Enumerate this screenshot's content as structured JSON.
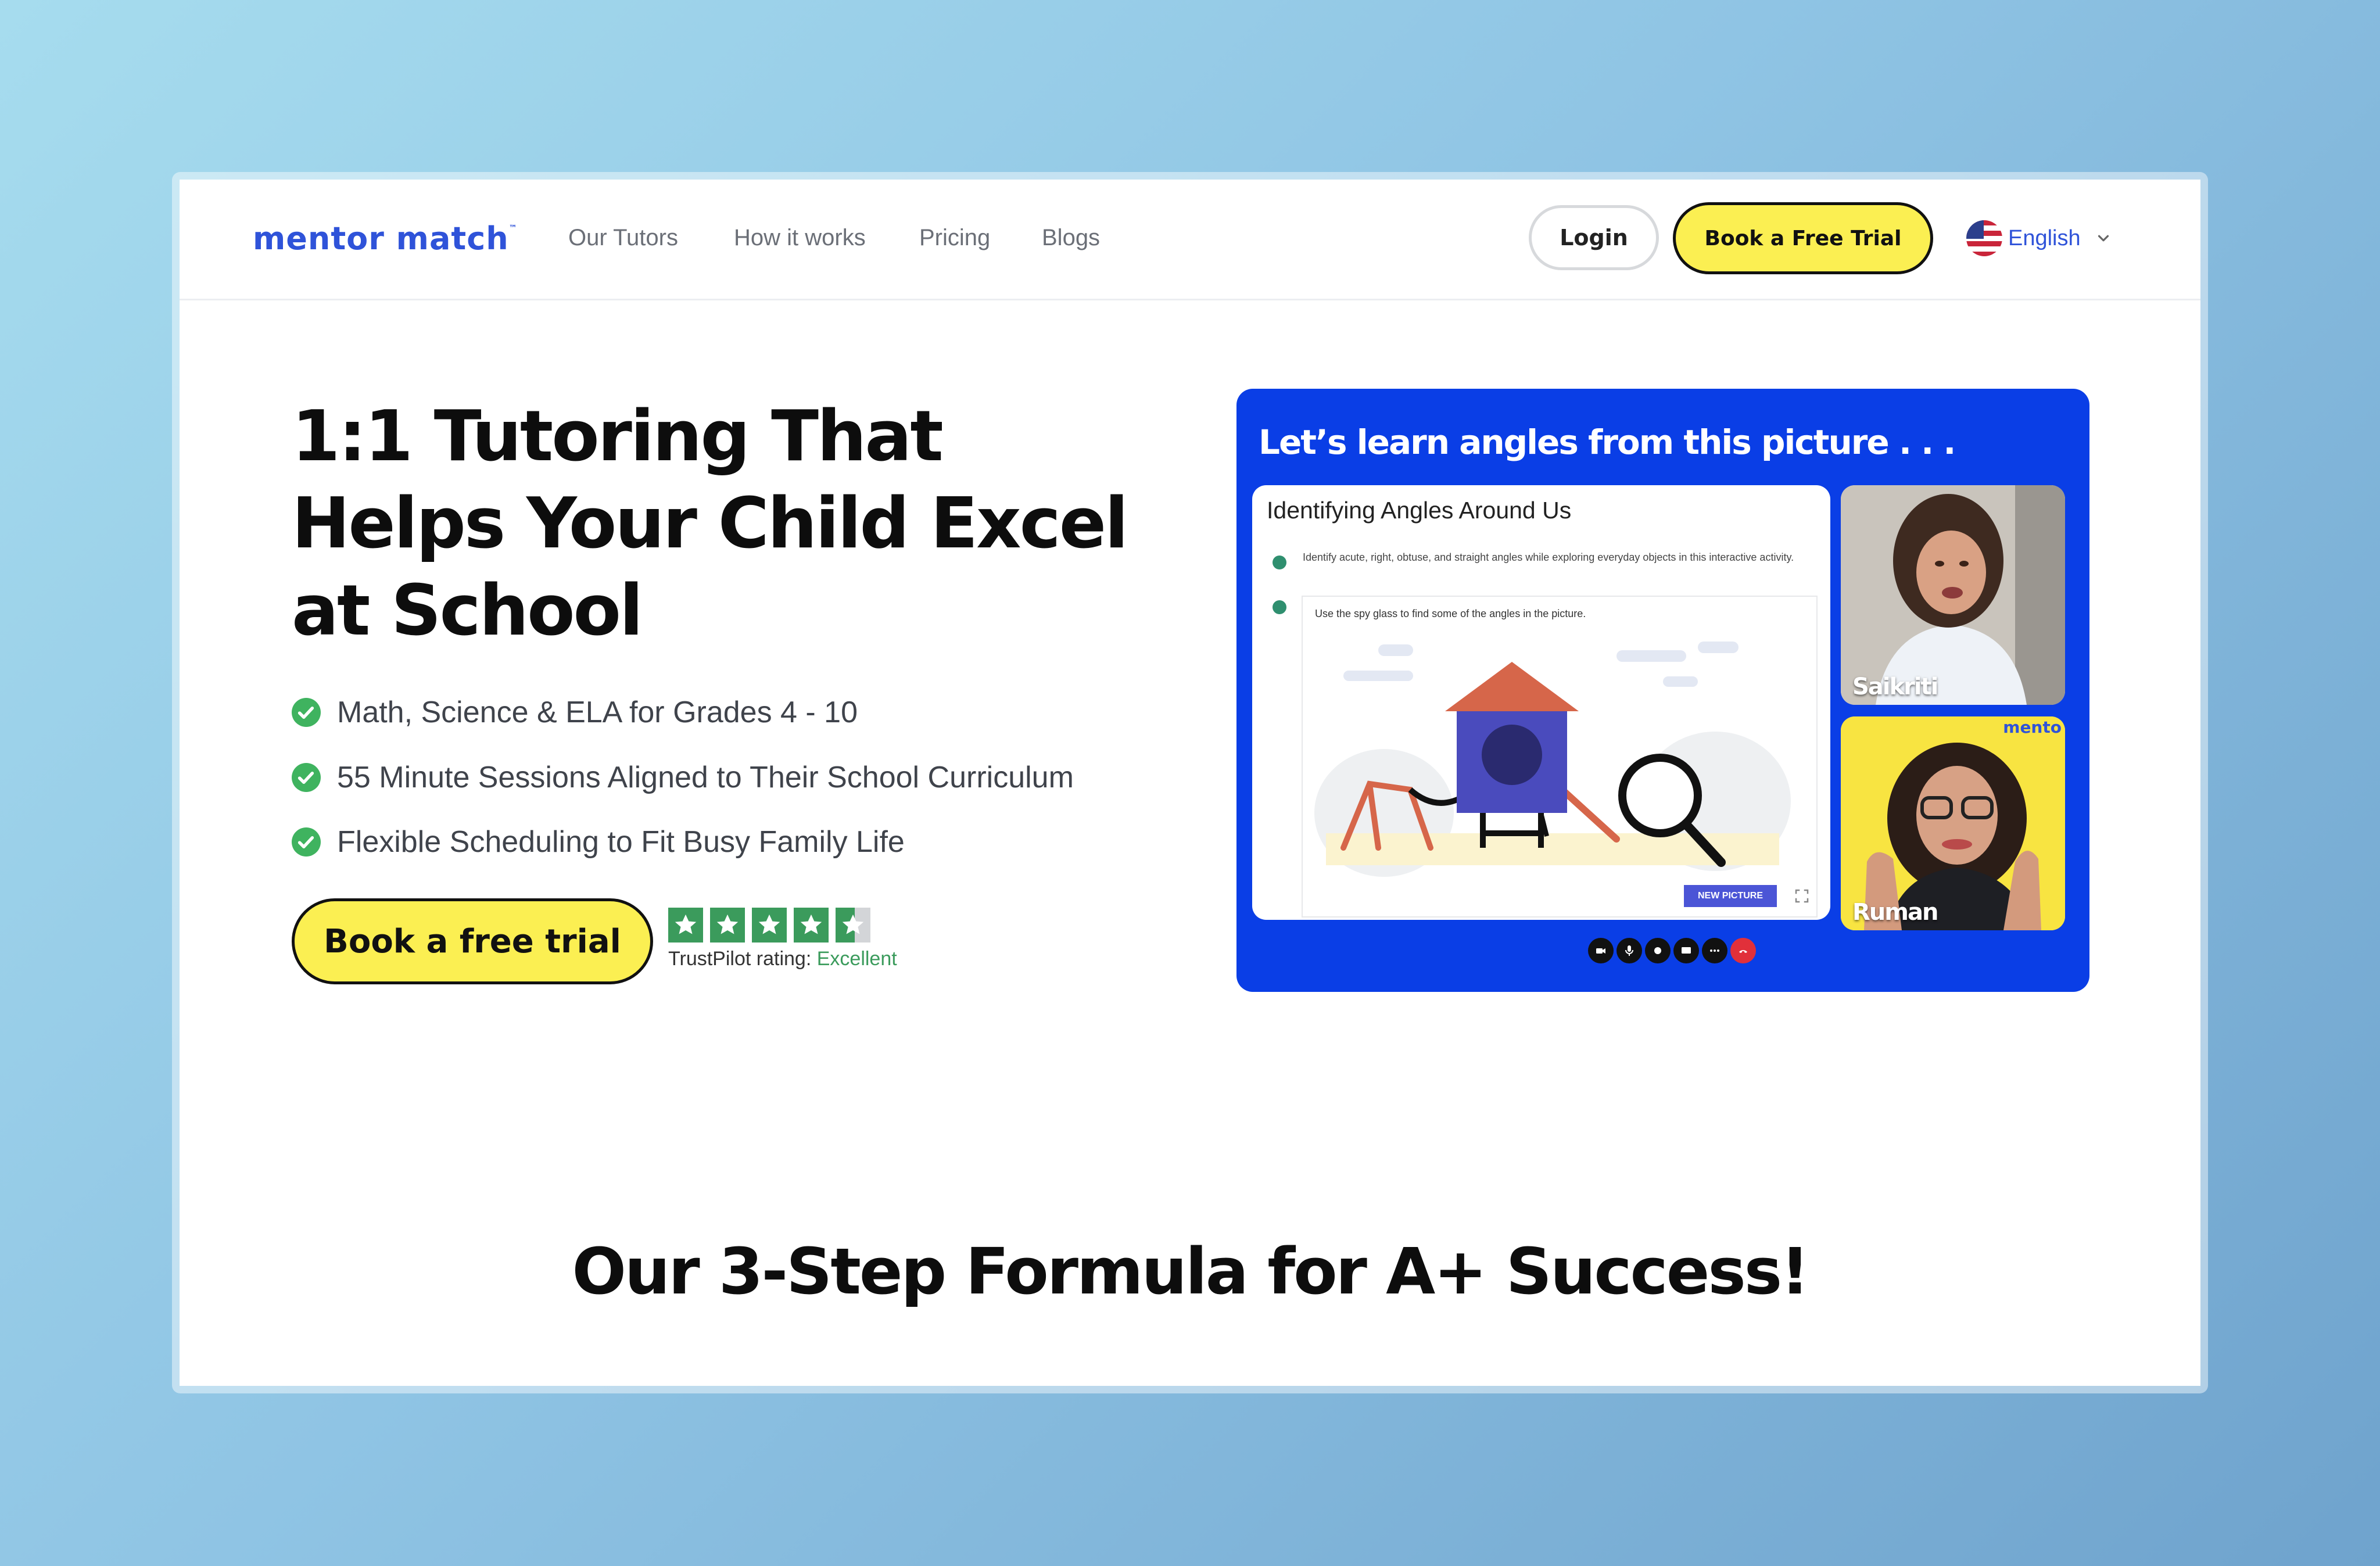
{
  "nav": {
    "logo": "mentor match",
    "logo_tm": "™",
    "links": [
      "Our Tutors",
      "How it works",
      "Pricing",
      "Blogs"
    ],
    "login_label": "Login",
    "trial_label": "Book a Free Trial",
    "language": "English",
    "language_icon": "us-flag-icon"
  },
  "hero": {
    "title": "1:1 Tutoring That Helps Your Child Excel at School",
    "features": [
      "Math, Science & ELA for Grades 4 - 10",
      "55 Minute Sessions Aligned to Their School Curriculum",
      "Flexible Scheduling to Fit Busy Family Life"
    ],
    "cta_label": "Book a free trial",
    "trustpilot": {
      "rating_label": "TrustPilot rating:",
      "rating_value": "Excellent",
      "stars": 4.5,
      "color": "#3b9b5c"
    }
  },
  "video": {
    "caption": "Let’s learn angles from this picture . . .",
    "lesson_title": "Identifying Angles Around Us",
    "lesson_desc": "Identify acute, right, obtuse, and straight angles while exploring everyday objects in this interactive activity.",
    "lesson_prompt": "Use the spy glass to find some of the angles in the picture.",
    "new_picture_label": "NEW PICTURE",
    "participants": [
      {
        "name": "Saikriti"
      },
      {
        "name": "Ruman",
        "brand": "mento"
      }
    ]
  },
  "section": {
    "title": "Our 3-Step Formula for A+ Success!"
  },
  "colors": {
    "brand_blue": "#2f53d9",
    "accent_yellow": "#fbef52",
    "video_blue": "#0a3ee6",
    "check_green": "#3fb35f"
  }
}
